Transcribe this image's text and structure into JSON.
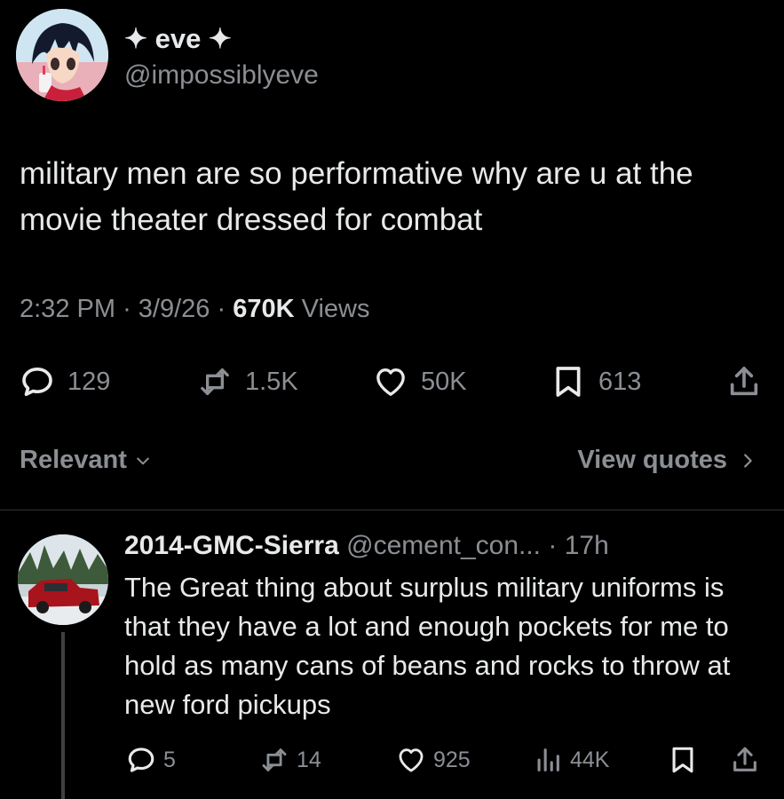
{
  "tweet": {
    "author_name": "✦ eve ✦",
    "author_handle": "@impossiblyeve",
    "text": "military men are so performative why are u at the movie theater dressed for combat",
    "time": "2:32 PM",
    "date": "3/9/26",
    "separator": "·",
    "views_count": "670K",
    "views_label": "Views",
    "stats": {
      "replies": "129",
      "reposts": "1.5K",
      "likes": "50K",
      "bookmarks": "613"
    }
  },
  "filter": {
    "sort_label": "Relevant",
    "view_quotes_label": "View quotes"
  },
  "reply": {
    "author_name": "2014-GMC-Sierra",
    "author_handle": "@cement_con...",
    "separator": "·",
    "time": "17h",
    "text": "The Great thing about surplus military uniforms is that they have a lot and enough pockets for me to hold as many cans of beans and rocks to throw at new ford pickups",
    "stats": {
      "replies": "5",
      "reposts": "14",
      "likes": "925",
      "views": "44K"
    }
  },
  "icons": {
    "reply": "speech-bubble-icon",
    "repost": "repost-arrows-icon",
    "like": "heart-icon",
    "bookmark": "bookmark-icon",
    "share": "share-upload-icon",
    "views": "bar-chart-icon"
  },
  "colors": {
    "background": "#000000",
    "primary_text": "#e7e9ea",
    "secondary_text": "#8b8f94",
    "divider": "#2f3336"
  }
}
